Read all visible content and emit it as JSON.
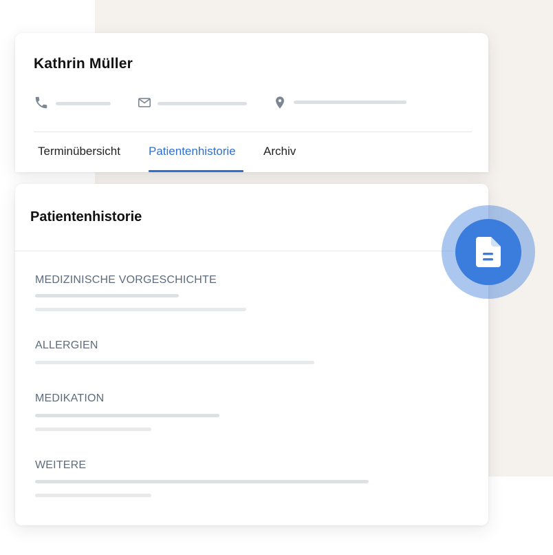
{
  "patient": {
    "name": "Kathrin Müller"
  },
  "contact": {
    "phone_icon": "phone-icon",
    "email_icon": "mail-icon",
    "location_icon": "location-pin-icon"
  },
  "tabs": [
    {
      "label": "Terminübersicht",
      "active": false
    },
    {
      "label": "Patientenhistorie",
      "active": true
    },
    {
      "label": "Archiv",
      "active": false
    }
  ],
  "history": {
    "title": "Patientenhistorie",
    "sections": [
      {
        "label": "MEDIZINISCHE VORGESCHICHTE"
      },
      {
        "label": "ALLERGIEN"
      },
      {
        "label": "MEDIKATION"
      },
      {
        "label": "WEITERE"
      }
    ]
  },
  "badge": {
    "icon": "document-icon"
  },
  "colors": {
    "accent": "#2f6fd1",
    "badge": "#3b7ddd",
    "background_panel": "#f5f2ee",
    "placeholder": "#dde1e6",
    "label": "#5d6b7c"
  }
}
